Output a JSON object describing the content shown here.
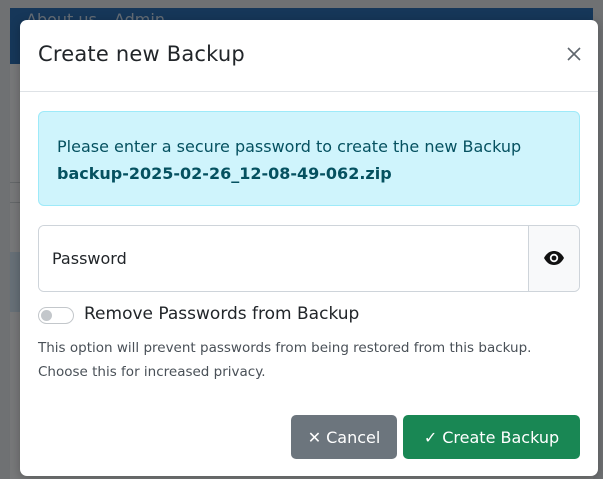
{
  "background": {
    "nav_links": [
      "About us",
      "Admin"
    ]
  },
  "modal": {
    "title": "Create new Backup",
    "close_icon": "close-icon",
    "info": {
      "message": "Please enter a secure password to create the new Backup",
      "filename": "backup-2025-02-26_12-08-49-062.zip"
    },
    "password": {
      "placeholder": "Password",
      "value": "",
      "toggle_icon": "eye-icon"
    },
    "remove_passwords": {
      "label": "Remove Passwords from Backup",
      "checked": false,
      "help": "This option will prevent passwords from being restored from this backup. Choose this for increased privacy."
    },
    "buttons": {
      "cancel_icon": "✕",
      "cancel_label": "Cancel",
      "create_icon": "✓",
      "create_label": "Create Backup"
    }
  },
  "colors": {
    "info_bg": "#cff4fc",
    "info_text": "#055160",
    "cancel_bg": "#6c757d",
    "create_bg": "#198754",
    "navbar": "#2c6fb3"
  }
}
